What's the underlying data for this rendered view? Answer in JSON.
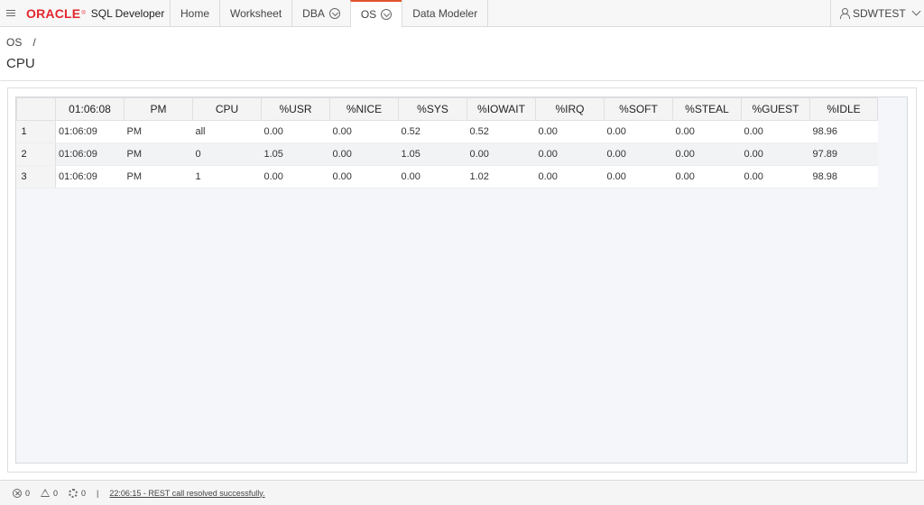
{
  "app": {
    "brand": "ORACLE",
    "registered_mark": "®",
    "product": "SQL Developer"
  },
  "nav": {
    "tabs": [
      {
        "label": "Home",
        "has_menu": false,
        "active": false
      },
      {
        "label": "Worksheet",
        "has_menu": false,
        "active": false
      },
      {
        "label": "DBA",
        "has_menu": true,
        "active": false
      },
      {
        "label": "OS",
        "has_menu": true,
        "active": true
      },
      {
        "label": "Data Modeler",
        "has_menu": false,
        "active": false
      }
    ],
    "user": "SDWTEST"
  },
  "breadcrumb": {
    "item": "OS",
    "separator": "/"
  },
  "page": {
    "title": "CPU"
  },
  "grid": {
    "columns": [
      "01:06:08",
      "PM",
      "CPU",
      "%USR",
      "%NICE",
      "%SYS",
      "%IOWAIT",
      "%IRQ",
      "%SOFT",
      "%STEAL",
      "%GUEST",
      "%IDLE"
    ],
    "rows": [
      {
        "num": "1",
        "cells": [
          "01:06:09",
          "PM",
          "all",
          "0.00",
          "0.00",
          "0.52",
          "0.52",
          "0.00",
          "0.00",
          "0.00",
          "0.00",
          "98.96"
        ]
      },
      {
        "num": "2",
        "cells": [
          "01:06:09",
          "PM",
          "0",
          "1.05",
          "0.00",
          "1.05",
          "0.00",
          "0.00",
          "0.00",
          "0.00",
          "0.00",
          "97.89"
        ]
      },
      {
        "num": "3",
        "cells": [
          "01:06:09",
          "PM",
          "1",
          "0.00",
          "0.00",
          "0.00",
          "1.02",
          "0.00",
          "0.00",
          "0.00",
          "0.00",
          "98.98"
        ]
      }
    ]
  },
  "status": {
    "errors": "0",
    "warnings": "0",
    "tasks": "0",
    "separator": "|",
    "message": "22:06:15 - REST call resolved successfully."
  },
  "colors": {
    "accent": "#e0552a",
    "brand_red": "#e4262e"
  }
}
